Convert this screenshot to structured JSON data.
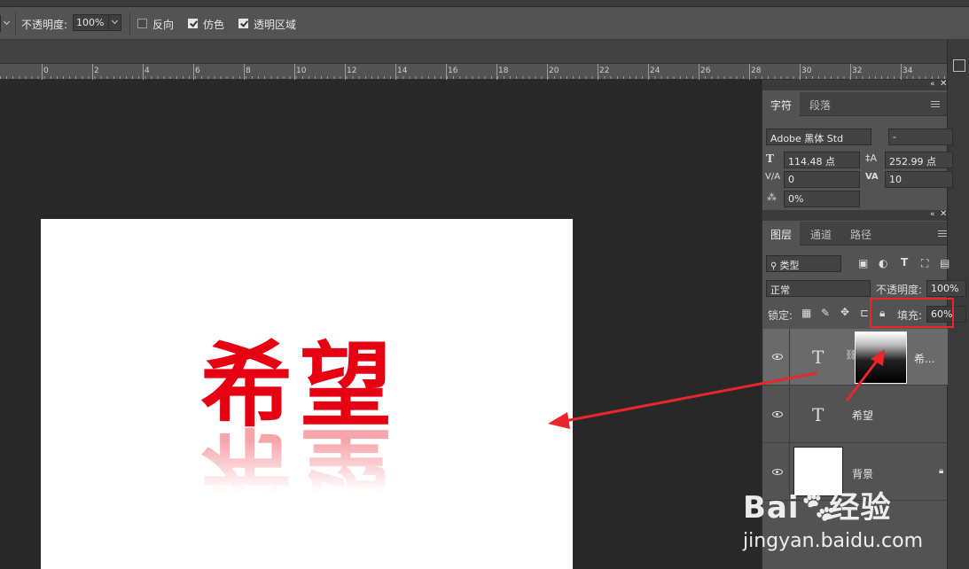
{
  "options_bar": {
    "opacity_label": "不透明度:",
    "opacity_value": "100%",
    "reverse_label": "反向",
    "dither_label": "仿色",
    "transparency_label": "透明区域",
    "reverse_checked": false,
    "dither_checked": true,
    "transparency_checked": true
  },
  "ruler": {
    "ticks": [
      "0",
      "2",
      "4",
      "6",
      "8",
      "10",
      "12",
      "14",
      "16",
      "18",
      "20",
      "22",
      "24",
      "26",
      "28",
      "30",
      "32",
      "34"
    ]
  },
  "canvas": {
    "text": "希望",
    "text_color": "#e60012"
  },
  "character_panel": {
    "tabs": [
      "字符",
      "段落"
    ],
    "font_family": "Adobe 黑体 Std",
    "font_style": "-",
    "font_size": "114.48 点",
    "leading": "252.99 点",
    "kerning": "0",
    "tracking": "10",
    "scale": "0%"
  },
  "layers_panel": {
    "tabs": [
      "图层",
      "通道",
      "路径"
    ],
    "filter_kind": "类型",
    "blend_mode": "正常",
    "opacity_label": "不透明度:",
    "opacity_value": "100%",
    "lock_label": "锁定:",
    "fill_label": "填充:",
    "fill_value": "60%",
    "layers": [
      {
        "name": "希...",
        "type": "text",
        "has_mask": true,
        "selected": true
      },
      {
        "name": "希望",
        "type": "text",
        "has_mask": false,
        "selected": false
      },
      {
        "name": "背景",
        "type": "image",
        "has_mask": false,
        "selected": false,
        "locked": true
      }
    ]
  },
  "watermark": {
    "brand": "Bai",
    "brand2": "经验",
    "url": "jingyan.baidu.com"
  },
  "colors": {
    "accent_red": "#e8262b",
    "panel_bg": "#535353",
    "workspace_bg": "#282828"
  }
}
